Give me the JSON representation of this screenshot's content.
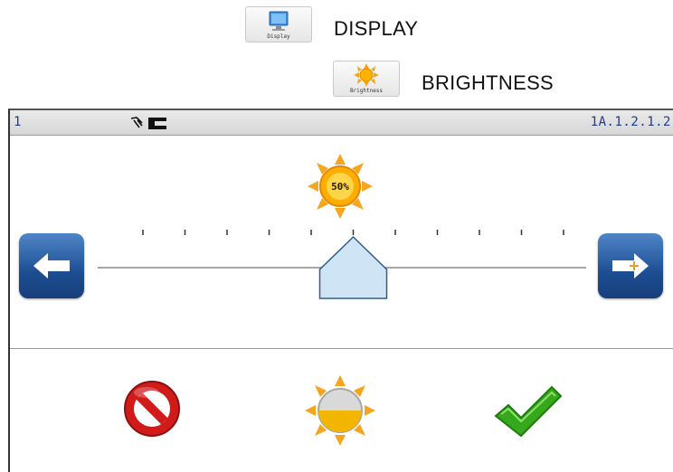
{
  "breadcrumb": {
    "items": [
      {
        "label": "DISPLAY",
        "icon_caption": "Display",
        "icon": "monitor-icon"
      },
      {
        "label": "BRIGHTNESS",
        "icon_caption": "Brightness",
        "icon": "sun-icon"
      }
    ]
  },
  "status_bar": {
    "left_text": "1",
    "right_text": "1A.1.2.1.2",
    "icons": [
      "hand-icon",
      "battery-icon"
    ]
  },
  "brightness": {
    "level_label": "50%",
    "level": 0.5,
    "tick_count": 11
  },
  "actions": {
    "cancel": "cancel-icon",
    "default": "default-brightness-icon",
    "confirm": "confirm-check-icon"
  },
  "colors": {
    "accent_blue": "#1d4e93",
    "status_text": "#1f3b8f",
    "sun_orange": "#f6a51c",
    "cancel_red": "#d11a1a",
    "confirm_green": "#35a81b",
    "slider_fill": "#cfe4f5"
  }
}
